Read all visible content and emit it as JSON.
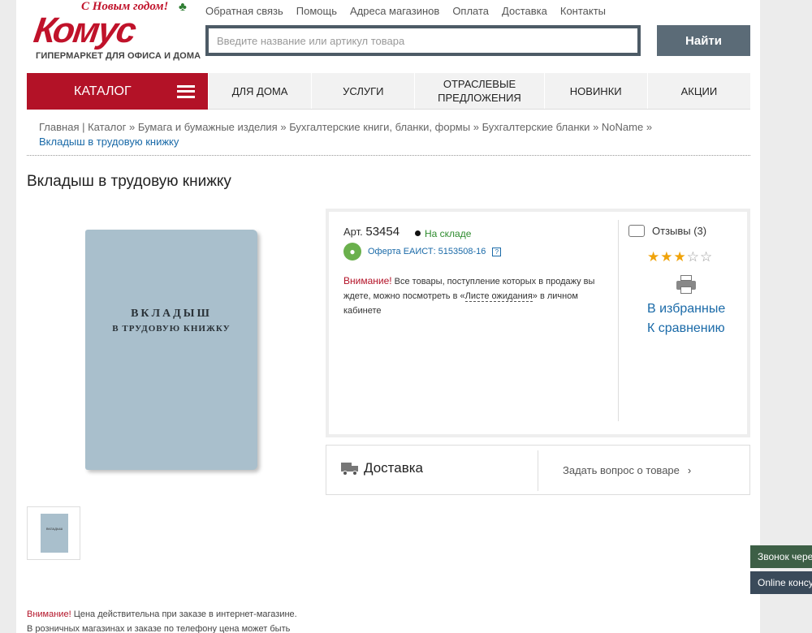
{
  "header": {
    "slogan": "С Новым годом!",
    "brand": "Комус",
    "tagline": "ГИПЕРМАРКЕТ ДЛЯ ОФИСА И ДОМА",
    "top_links": [
      "Обратная связь",
      "Помощь",
      "Адреса магазинов",
      "Оплата",
      "Доставка",
      "Контакты"
    ],
    "search_placeholder": "Введите название или артикул товара",
    "search_value": "",
    "search_button": "Найти"
  },
  "mainnav": {
    "catalog": "КАТАЛОГ",
    "items": [
      "ДЛЯ ДОМА",
      "УСЛУГИ",
      "ОТРАСЛЕВЫЕ ПРЕДЛОЖЕНИЯ",
      "НОВИНКИ",
      "АКЦИИ"
    ]
  },
  "breadcrumbs": {
    "items": [
      "Главная",
      "Каталог",
      "Бумага и бумажные изделия",
      "Бухгалтерские книги, бланки, формы",
      "Бухгалтерские бланки",
      "NoName"
    ],
    "current": "Вкладыш в трудовую книжку"
  },
  "product": {
    "title": "Вкладыш в трудовую книжку",
    "cover_line1": "ВКЛАДЫШ",
    "cover_line2": "В ТРУДОВУЮ КНИЖКУ",
    "art_label": "Арт.",
    "art_number": "53454",
    "stock_status": "На складе",
    "eaist_text": "Оферта ЕАИСТ: 5153508-16",
    "notice_label": "Внимание!",
    "notice_pre": " Все товары, поступление которых в продажу вы ждете, можно посмотреть в «",
    "notice_link": "Листе ожидания",
    "notice_post": "» в личном кабинете",
    "reviews": "Отзывы (3)",
    "rating": 3,
    "rating_max": 5,
    "favorites": "В избранные",
    "compare": "К сравнению",
    "delivery": "Доставка",
    "ask_question": "Задать вопрос о товаре"
  },
  "price_note": {
    "label": "Внимание!",
    "line1": " Цена действительна при заказе в интернет-магазине.",
    "line2": "В розничных магазинах и заказе по телефону цена может быть"
  },
  "side_tabs": {
    "callback": "Звонок через",
    "online": "Online консультант"
  },
  "colors": {
    "brand_red": "#b31227",
    "link_blue": "#1a6aa8",
    "stock_green": "#2e8b2e",
    "star_gold": "#f0a30a"
  }
}
